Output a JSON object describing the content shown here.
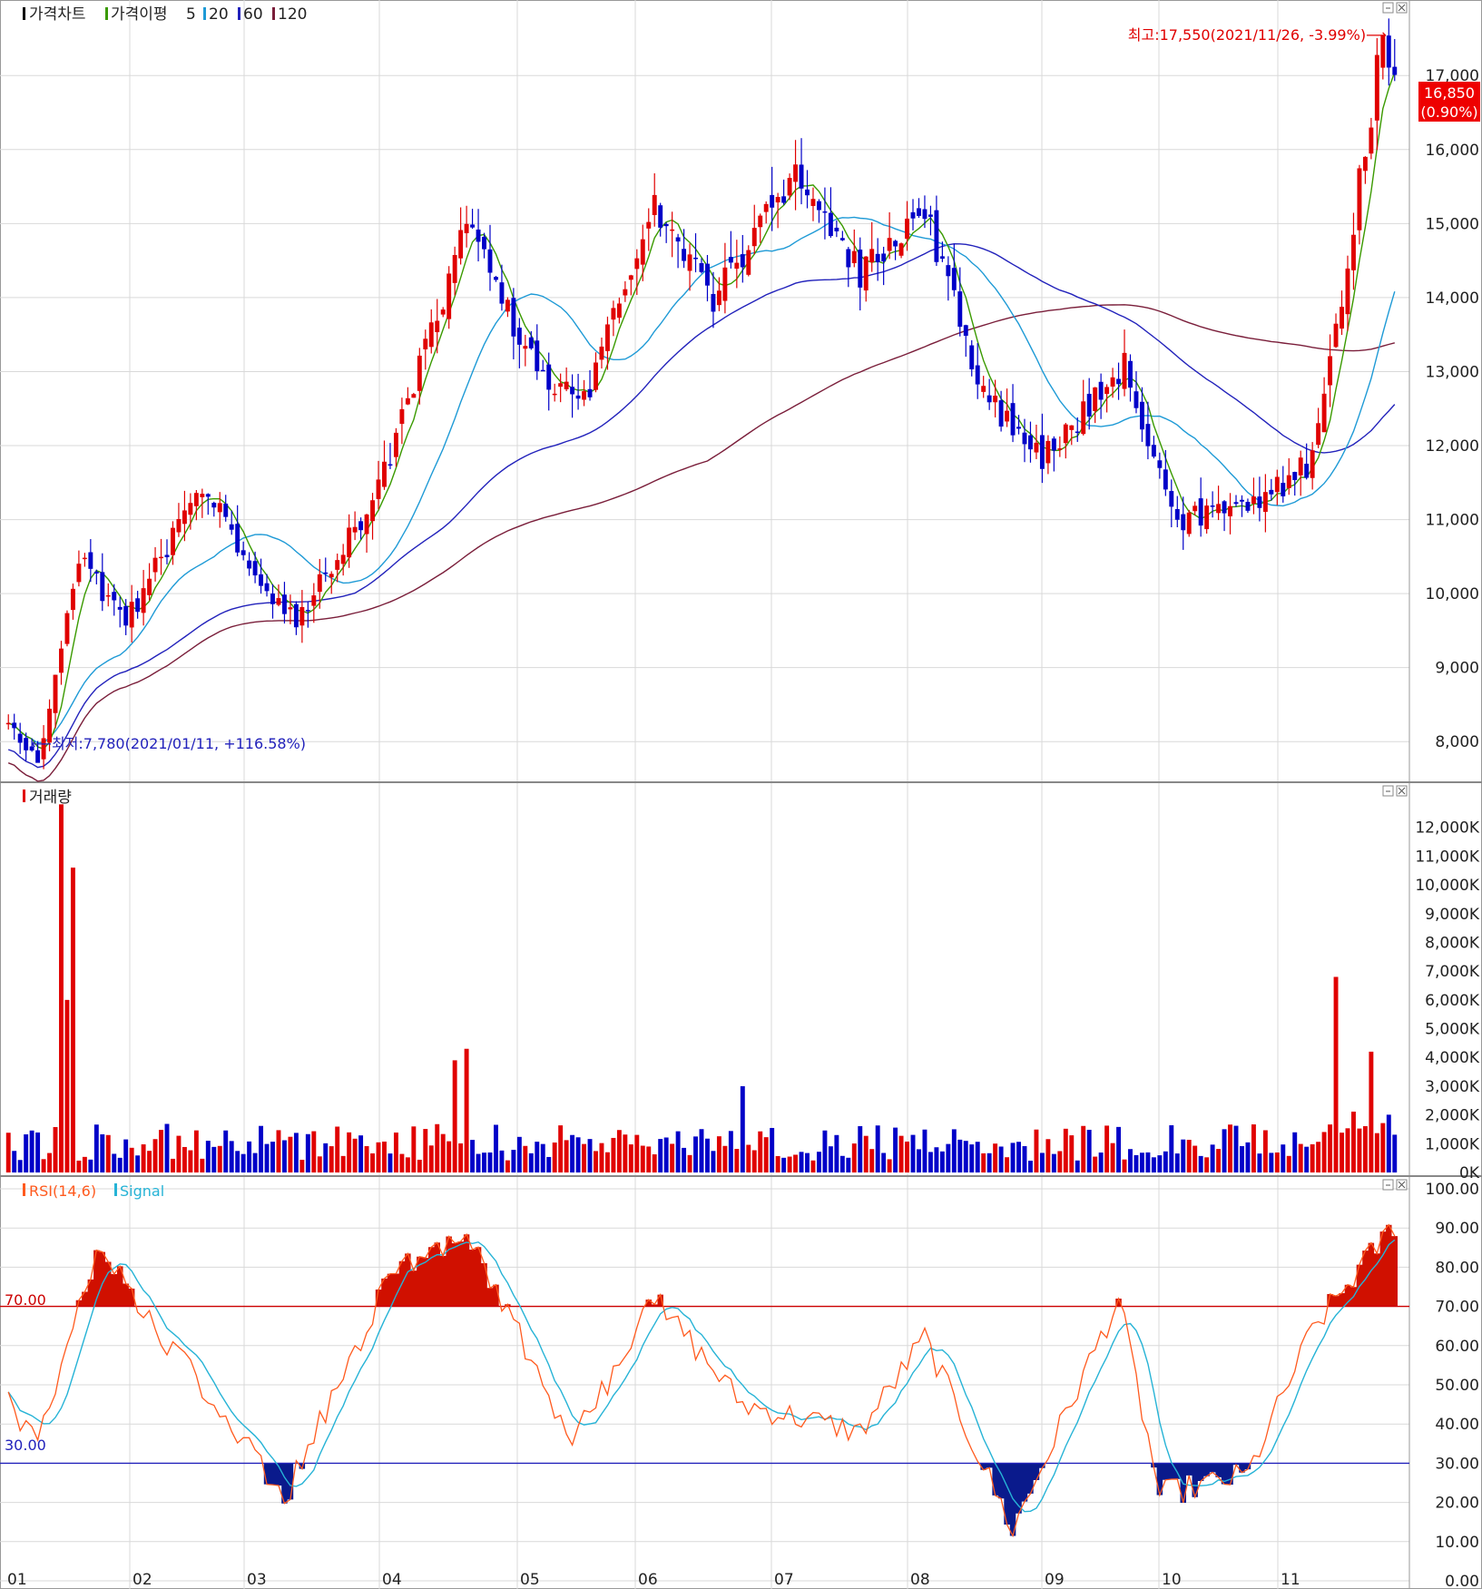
{
  "colors": {
    "up": "#e00000",
    "down": "#0000c8",
    "ma5": "#3a9a00",
    "ma20": "#1e9ad6",
    "ma60": "#2222bb",
    "ma120": "#7a1e3a",
    "rsi": "#ff5a1e",
    "signal": "#26b3d6",
    "grid": "#d9d9d9",
    "axis": "#555555",
    "rsi_high_fill": "#d01000",
    "rsi_low_fill": "#0a1a8c",
    "price_tag_bg": "#ee0000",
    "price_tag_text": "#ffffff",
    "pane_title_price": "#000000",
    "pane_title_volume": "#e00000"
  },
  "price_pane": {
    "title": "가격차트",
    "ma_label": "가격이평",
    "ma_periods": [
      "5",
      "20",
      "60",
      "120"
    ],
    "y_ticks": [
      "17,000",
      "16,000",
      "15,000",
      "14,000",
      "13,000",
      "12,000",
      "11,000",
      "10,000",
      "9,000",
      "8,000"
    ],
    "current_price": "16,850",
    "current_change": "(0.90%)",
    "high_annotation": "최고:17,550(2021/11/26, -3.99%)⟶",
    "low_annotation": "⟵최저:7,780(2021/01/11, +116.58%)"
  },
  "volume_pane": {
    "title": "거래량",
    "y_ticks": [
      "12,000K",
      "11,000K",
      "10,000K",
      "9,000K",
      "8,000K",
      "7,000K",
      "6,000K",
      "5,000K",
      "4,000K",
      "3,000K",
      "2,000K",
      "1,000K",
      "0K"
    ]
  },
  "rsi_pane": {
    "title_rsi": "RSI(14,6)",
    "title_signal": "Signal",
    "y_ticks": [
      "100.00",
      "90.00",
      "80.00",
      "70.00",
      "60.00",
      "50.00",
      "40.00",
      "30.00",
      "20.00",
      "10.00",
      "0.00"
    ],
    "upper_level": "70.00",
    "lower_level": "30.00"
  },
  "x_labels": [
    "01",
    "02",
    "03",
    "04",
    "05",
    "06",
    "07",
    "08",
    "09",
    "10",
    "11"
  ],
  "chart_data": [
    {
      "type": "candlestick",
      "title": "가격차트",
      "x_range": [
        "2021-01-04",
        "2021-11-30"
      ],
      "ylim": [
        7500,
        17800
      ],
      "key_points": [
        {
          "date": "2021-01-04",
          "price": 8200
        },
        {
          "date": "2021-01-11",
          "price": 7780,
          "label": "최저"
        },
        {
          "date": "2021-01-20",
          "price": 10500
        },
        {
          "date": "2021-02-01",
          "price": 9600
        },
        {
          "date": "2021-02-18",
          "price": 11500
        },
        {
          "date": "2021-03-05",
          "price": 10000
        },
        {
          "date": "2021-03-12",
          "price": 9600
        },
        {
          "date": "2021-04-01",
          "price": 11400
        },
        {
          "date": "2021-04-22",
          "price": 15000
        },
        {
          "date": "2021-05-10",
          "price": 13000
        },
        {
          "date": "2021-05-20",
          "price": 12600
        },
        {
          "date": "2021-06-07",
          "price": 15300
        },
        {
          "date": "2021-06-21",
          "price": 14000
        },
        {
          "date": "2021-07-09",
          "price": 15700
        },
        {
          "date": "2021-07-26",
          "price": 14300
        },
        {
          "date": "2021-08-10",
          "price": 15200
        },
        {
          "date": "2021-08-24",
          "price": 12700
        },
        {
          "date": "2021-09-07",
          "price": 11800
        },
        {
          "date": "2021-09-27",
          "price": 13100
        },
        {
          "date": "2021-10-08",
          "price": 11000
        },
        {
          "date": "2021-10-26",
          "price": 11100
        },
        {
          "date": "2021-11-10",
          "price": 11800
        },
        {
          "date": "2021-11-18",
          "price": 14500
        },
        {
          "date": "2021-11-26",
          "price": 17550,
          "label": "최고"
        },
        {
          "date": "2021-11-30",
          "price": 16850
        }
      ],
      "series": [
        {
          "name": "5",
          "type": "line"
        },
        {
          "name": "20",
          "type": "line"
        },
        {
          "name": "60",
          "type": "line"
        },
        {
          "name": "120",
          "type": "line"
        }
      ]
    },
    {
      "type": "bar",
      "title": "거래량",
      "unit": "K",
      "ylim": [
        0,
        13000
      ],
      "key_points": [
        {
          "date": "2021-01-15",
          "value": 12800
        },
        {
          "date": "2021-01-18",
          "value": 6000
        },
        {
          "date": "2021-01-19",
          "value": 10600
        },
        {
          "date": "2021-04-20",
          "value": 3900
        },
        {
          "date": "2021-04-22",
          "value": 4300
        },
        {
          "date": "2021-06-28",
          "value": 3000
        },
        {
          "date": "2021-11-16",
          "value": 6800
        },
        {
          "date": "2021-11-24",
          "value": 4200
        }
      ]
    },
    {
      "type": "line",
      "title": "RSI(14,6)",
      "ylim": [
        0,
        100
      ],
      "levels": [
        70,
        30
      ],
      "key_points": [
        {
          "date": "2021-01-04",
          "rsi": 45
        },
        {
          "date": "2021-01-11",
          "rsi": 35
        },
        {
          "date": "2021-01-25",
          "rsi": 85
        },
        {
          "date": "2021-03-10",
          "rsi": 21
        },
        {
          "date": "2021-04-05",
          "rsi": 78
        },
        {
          "date": "2021-04-22",
          "rsi": 90
        },
        {
          "date": "2021-05-18",
          "rsi": 35
        },
        {
          "date": "2021-06-07",
          "rsi": 72
        },
        {
          "date": "2021-06-28",
          "rsi": 45
        },
        {
          "date": "2021-07-26",
          "rsi": 38
        },
        {
          "date": "2021-08-10",
          "rsi": 62
        },
        {
          "date": "2021-08-31",
          "rsi": 13
        },
        {
          "date": "2021-09-24",
          "rsi": 72
        },
        {
          "date": "2021-10-05",
          "rsi": 22
        },
        {
          "date": "2021-10-26",
          "rsi": 27
        },
        {
          "date": "2021-11-10",
          "rsi": 64
        },
        {
          "date": "2021-11-30",
          "rsi": 91
        }
      ],
      "series": [
        {
          "name": "RSI(14,6)"
        },
        {
          "name": "Signal"
        }
      ]
    }
  ]
}
